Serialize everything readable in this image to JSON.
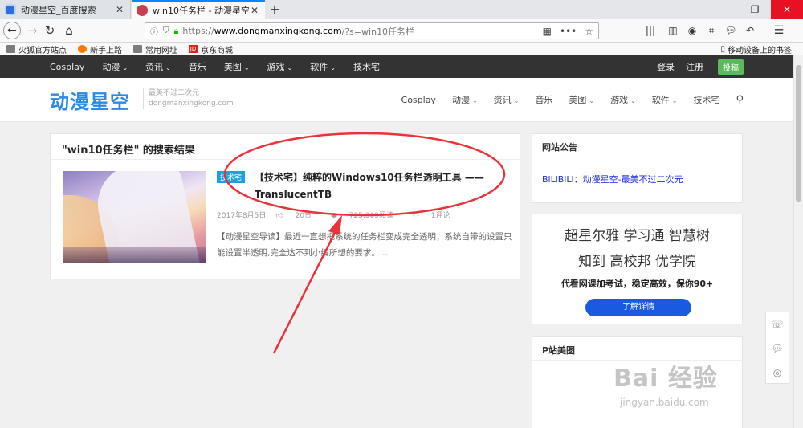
{
  "browser": {
    "tabs": [
      {
        "title": "动漫星空_百度搜索",
        "close": "✕"
      },
      {
        "title": "win10任务栏 - 动漫星空",
        "close": "✕"
      }
    ],
    "new_tab": "+",
    "window_controls": {
      "minimize": "—",
      "restore": "❐",
      "close": "✕"
    },
    "url": {
      "proto": "https://",
      "host": "www.dongmanxingkong.com",
      "path": "/?s=win10任务栏"
    },
    "bookmarks": [
      "火狐官方站点",
      "新手上路",
      "常用网址",
      "京东商城"
    ],
    "mobile_bookmarks": "移动设备上的书签",
    "jd_icon": "JD"
  },
  "site": {
    "topnav": [
      "Cosplay",
      "动漫",
      "资讯",
      "音乐",
      "美图",
      "游戏",
      "软件",
      "技术宅"
    ],
    "login": "登录",
    "register": "注册",
    "post_button": "投稿",
    "logo": "动漫星空",
    "slogan": "最美不过二次元",
    "slogan_domain": "dongmanxingkong.com",
    "mainnav": [
      "Cosplay",
      "动漫",
      "资讯",
      "音乐",
      "美图",
      "游戏",
      "软件",
      "技术宅"
    ]
  },
  "results": {
    "title": "\"win10任务栏\" 的搜索结果",
    "post": {
      "tag": "技术宅",
      "title": "【技术宅】纯粹的Windows10任务栏透明工具 —— TranslucentTB",
      "date": "2017年8月5日",
      "likes": "20赞",
      "views": "725,309阅读",
      "comments": "1评论",
      "excerpt": "【动漫星空导读】最近一直想把系统的任务栏变成完全透明，系统自带的设置只能设置半透明,完全达不到小编所想的要求。..."
    }
  },
  "sidebar": {
    "notice_title": "网站公告",
    "notice_link": "BiLiBiLi：动漫星空-最美不过二次元",
    "ad": {
      "line1": "超星尔雅 学习通 智慧树",
      "line2": "知到 高校邦 优学院",
      "line3": "代看网课加考试，稳定高效，保你90+",
      "button": "了解详情"
    },
    "pzhan_title": "P站美图"
  },
  "watermark": {
    "big": "Bai 经验",
    "small": "jingyan.baidu.com"
  },
  "colors": {
    "accent_blue": "#2a8ae8",
    "tag_blue": "#1ba1e2",
    "post_green": "#5cb85c",
    "annotation_red": "#e8333a"
  }
}
